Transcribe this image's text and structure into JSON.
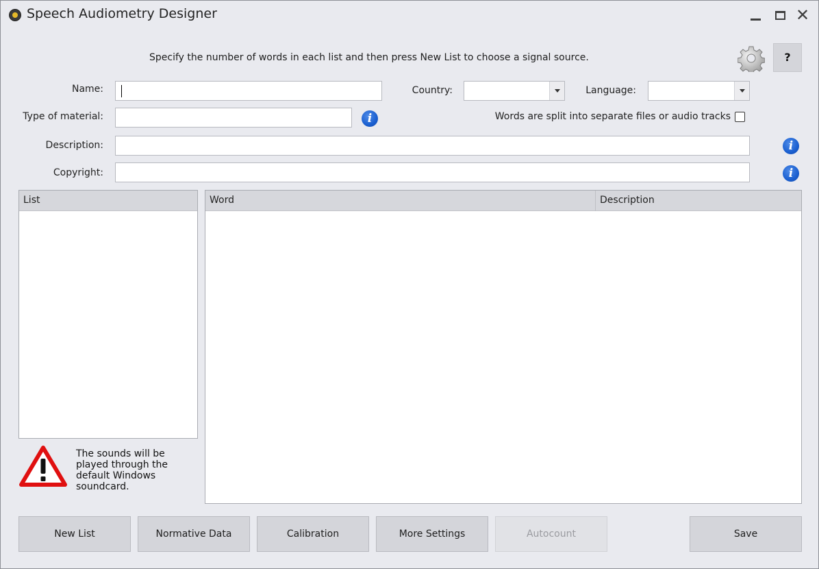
{
  "window": {
    "title": "Speech Audiometry Designer",
    "controls": {
      "minimize": "minimize",
      "maximize": "maximize",
      "close": "✕"
    }
  },
  "instruction": "Specify the number of words in each list and then press New List to choose a signal source.",
  "toolbar": {
    "help_label": "?",
    "settings_icon": "gear-icon"
  },
  "form": {
    "name_label": "Name:",
    "name_value": "",
    "country_label": "Country:",
    "country_value": "",
    "language_label": "Language:",
    "language_value": "",
    "type_label": "Type of material:",
    "type_value": "",
    "split_label": "Words are split into separate files or audio tracks",
    "split_checked": false,
    "description_label": "Description:",
    "description_value": "",
    "copyright_label": "Copyright:",
    "copyright_value": ""
  },
  "list_grid": {
    "header": "List",
    "rows": []
  },
  "word_grid": {
    "columns": [
      "Word",
      "Description"
    ],
    "rows": []
  },
  "warning": {
    "icon": "warning-icon",
    "text": "The sounds will be played through the default Windows soundcard."
  },
  "buttons": {
    "new_list": "New List",
    "normative_data": "Normative Data",
    "calibration": "Calibration",
    "more_settings": "More Settings",
    "autocount": "Autocount",
    "save": "Save"
  },
  "colors": {
    "window_bg": "#e9eaef",
    "button_bg": "#d4d5da",
    "info_blue": "#1a5fd0",
    "warning_red": "#e01010"
  }
}
